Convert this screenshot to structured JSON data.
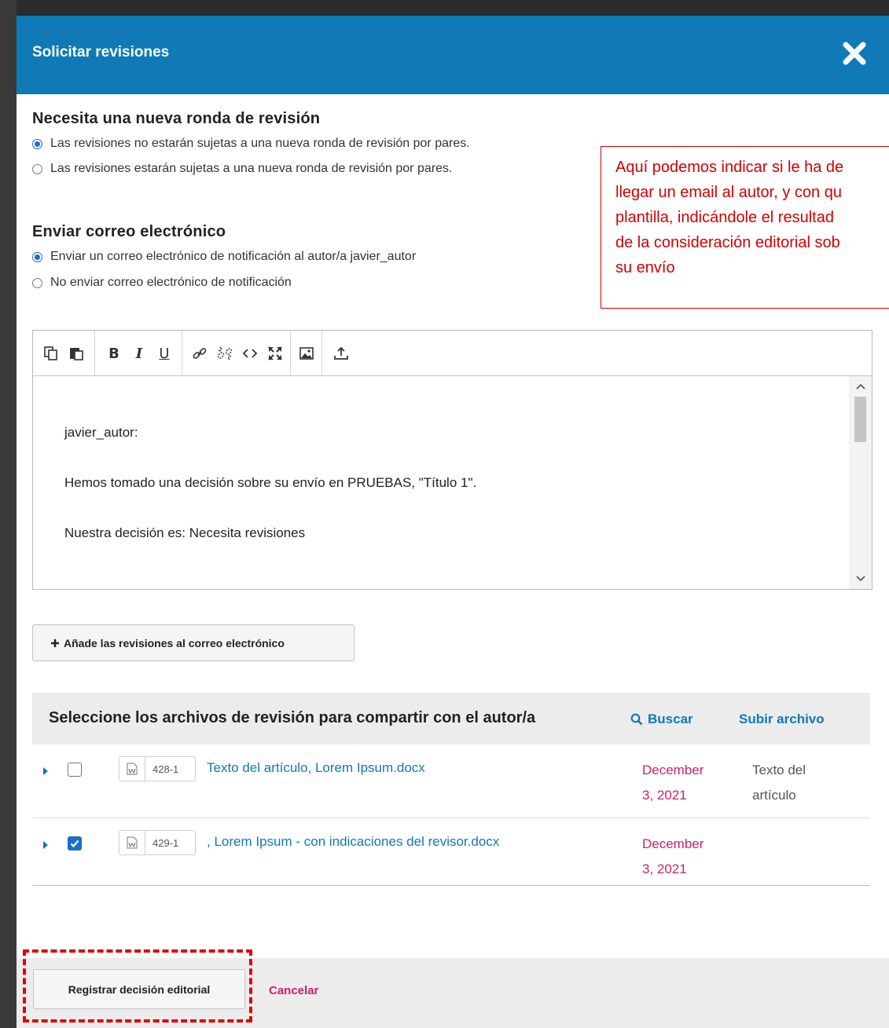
{
  "modal": {
    "title": "Solicitar revisiones"
  },
  "review_round": {
    "title": "Necesita una nueva ronda de revisión",
    "options": [
      "Las revisiones no estarán sujetas a una nueva ronda de revisión por pares.",
      "Las revisiones estarán sujetas a una nueva ronda de revisión por pares."
    ],
    "selected_index": 0
  },
  "email": {
    "title": "Enviar correo electrónico",
    "options": [
      "Enviar un correo electrónico de notificación al autor/a javier_autor",
      "No enviar correo electrónico de notificación"
    ],
    "selected_index": 0
  },
  "annotation": {
    "lines": [
      "Aquí podemos indicar si le ha de",
      "llegar un email al autor, y con qu",
      "plantilla, indicándole el resultad",
      "de la consideración editorial sob",
      "su envío"
    ]
  },
  "editor": {
    "toolbar_icons": [
      "copy-icon",
      "paste-icon",
      "bold-icon",
      "italic-icon",
      "underline-icon",
      "link-icon",
      "unlink-icon",
      "code-icon",
      "fullscreen-icon",
      "image-icon",
      "upload-icon"
    ],
    "toolbar_glyphs": {
      "bold": "B",
      "italic": "I",
      "underline": "U"
    },
    "lines": [
      "javier_autor:",
      "Hemos tomado una decisión sobre su envío en PRUEBAS, \"Título 1\".",
      "Nuestra decisión es: Necesita revisiones"
    ]
  },
  "add_revisions_button": "Añade las revisiones al correo electrónico",
  "files": {
    "title": "Seleccione los archivos de revisión para compartir con el autor/a",
    "search_label": "Buscar",
    "upload_label": "Subir archivo",
    "rows": [
      {
        "checked": false,
        "id": "428-1",
        "name": "Texto del artículo, Lorem Ipsum.docx",
        "date_line1": "December",
        "date_line2": "3, 2021",
        "type_line1": "Texto del",
        "type_line2": "artículo"
      },
      {
        "checked": true,
        "id": "429-1",
        "name": ", Lorem Ipsum - con indicaciones del revisor.docx",
        "date_line1": "December",
        "date_line2": "3, 2021",
        "type_line1": "",
        "type_line2": ""
      }
    ]
  },
  "footer": {
    "submit_label": "Registrar decisión editorial",
    "cancel_label": "Cancelar"
  },
  "colors": {
    "header": "#0f7ab5",
    "link": "#0f7ab5",
    "date": "#cc1f6e",
    "annotation": "#d20000"
  }
}
